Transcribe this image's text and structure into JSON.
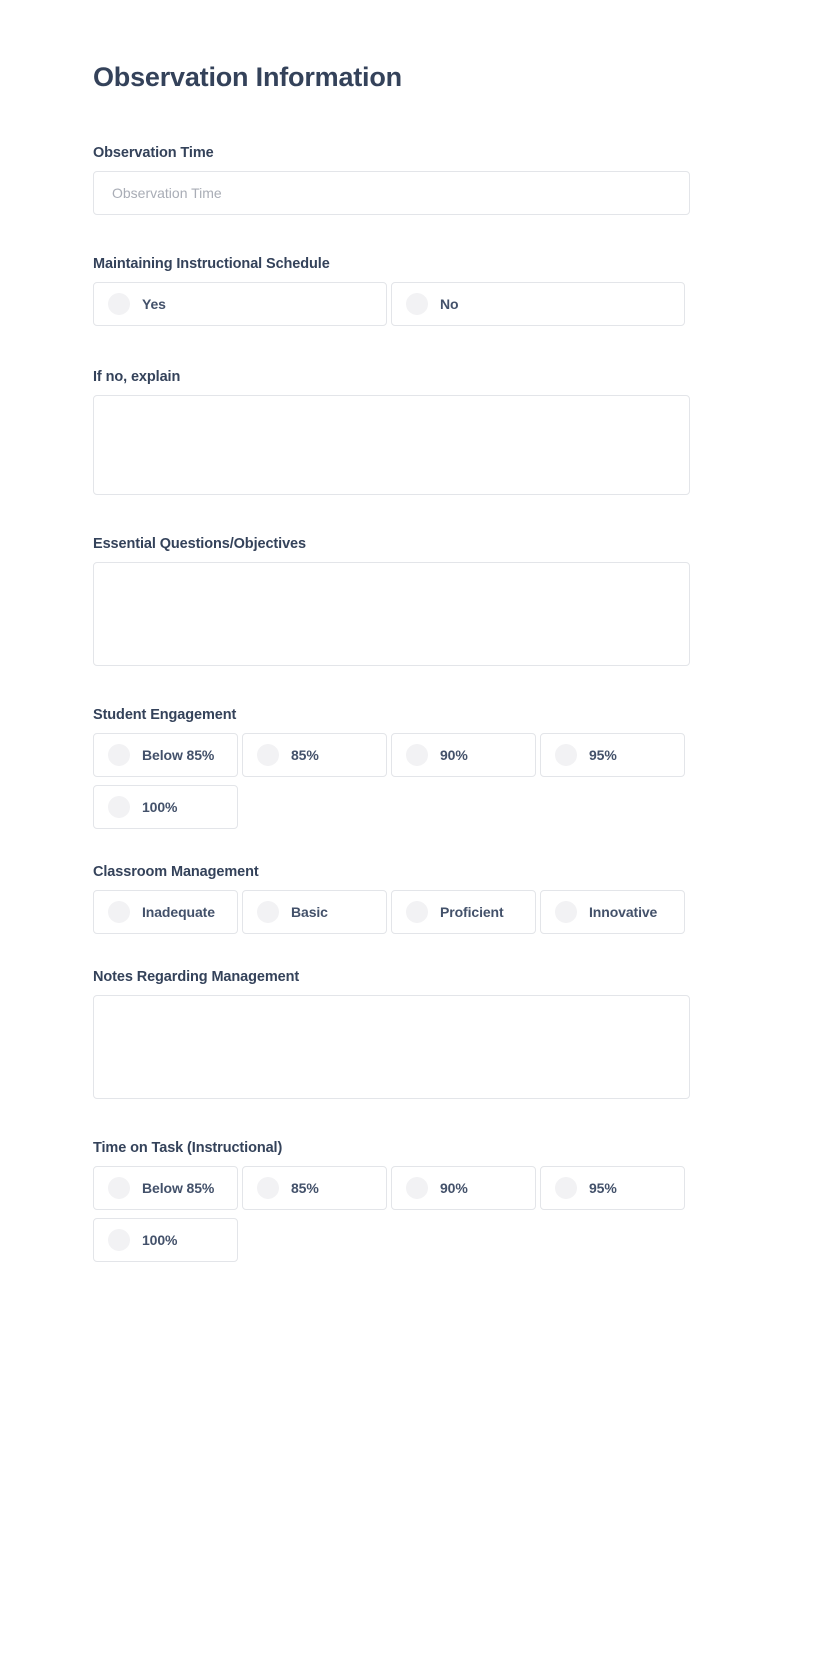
{
  "form": {
    "title": "Observation Information",
    "fields": [
      {
        "label": "Observation Time",
        "type": "text",
        "placeholder": "Observation Time",
        "value": ""
      },
      {
        "label": "Maintaining Instructional Schedule",
        "type": "radio-half",
        "options": [
          "Yes",
          "No"
        ]
      },
      {
        "label": "If no, explain",
        "type": "textarea",
        "value": ""
      },
      {
        "label": "Essential Questions/Objectives",
        "type": "textarea",
        "value": ""
      },
      {
        "label": "Student Engagement",
        "type": "radio-quarter",
        "options": [
          "Below 85%",
          "85%",
          "90%",
          "95%",
          "100%"
        ]
      },
      {
        "label": "Classroom Management",
        "type": "radio-quarter",
        "options": [
          "Inadequate",
          "Basic",
          "Proficient",
          "Innovative"
        ]
      },
      {
        "label": "Notes Regarding Management",
        "type": "textarea",
        "value": ""
      },
      {
        "label": "Time on Task (Instructional)",
        "type": "radio-quarter",
        "options": [
          "Below 85%",
          "85%",
          "90%",
          "95%",
          "100%"
        ]
      }
    ]
  },
  "colors": {
    "label": "#34425a",
    "border": "#e3e5e9",
    "radio": "#f2f2f4",
    "placeholder": "#a9adb6",
    "background": "#ffffff"
  }
}
